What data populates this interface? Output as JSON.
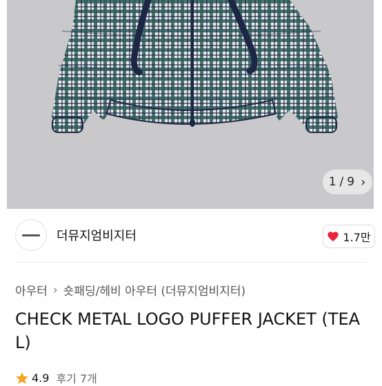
{
  "gallery": {
    "counter_current": "1",
    "counter_sep": "/",
    "counter_total": "9",
    "next_icon": "chevron-right-icon",
    "bg_color": "#c9c9cb",
    "jacket_color": "#2f5a5a",
    "trim_color": "#1c2645"
  },
  "brand": {
    "name": "더뮤지엄비지터",
    "logo_icon": "brand-logo"
  },
  "like": {
    "count": "1.7만",
    "icon": "heart-icon",
    "icon_color": "#e8253a"
  },
  "breadcrumb": {
    "category": "아우터",
    "subcategory": "숏패딩/헤비 아우터 (더뮤지엄비지터)"
  },
  "product": {
    "title": "CHECK METAL LOGO PUFFER JACKET (TEAL)"
  },
  "rating": {
    "star_icon": "star-icon",
    "star_color": "#f5a623",
    "score": "4.9",
    "reviews": "후기 7개"
  }
}
